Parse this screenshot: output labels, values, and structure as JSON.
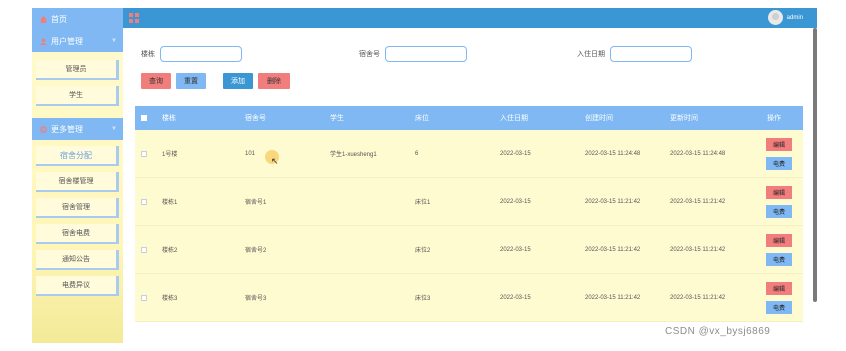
{
  "sidebar": {
    "home_label": "首页",
    "menus": [
      {
        "label": "用户管理",
        "items": [
          "管理员",
          "学生"
        ]
      },
      {
        "label": "更多管理",
        "items": [
          "宿舍分配",
          "宿舍楼管理",
          "宿舍管理",
          "宿舍电费",
          "通知公告",
          "电费异议"
        ]
      }
    ]
  },
  "topbar": {
    "username": "admin"
  },
  "search": {
    "building_label": "楼栋",
    "building_value": "",
    "room_label": "宿舍号",
    "room_value": "",
    "date_label": "入住日期",
    "date_value": ""
  },
  "toolbar": {
    "query": "查询",
    "reset": "重置",
    "add": "添加",
    "delete": "删除"
  },
  "table": {
    "headers": [
      "楼栋",
      "宿舍号",
      "学生",
      "床位",
      "入住日期",
      "创建时间",
      "更新时间",
      "操作"
    ],
    "rows": [
      [
        "1号楼",
        "101",
        "学生1-xuesheng1",
        "6",
        "2022-03-15",
        "2022-03-15 11:24:48",
        "2022-03-15 11:24:48"
      ],
      [
        "楼栋1",
        "宿舍号1",
        "",
        "床位1",
        "2022-03-15",
        "2022-03-15 11:21:42",
        "2022-03-15 11:21:42"
      ],
      [
        "楼栋2",
        "宿舍号2",
        "",
        "床位2",
        "2022-03-15",
        "2022-03-15 11:21:42",
        "2022-03-15 11:21:42"
      ],
      [
        "楼栋3",
        "宿舍号3",
        "",
        "床位3",
        "2022-03-15",
        "2022-03-15 11:21:42",
        "2022-03-15 11:21:42"
      ]
    ],
    "edit_label": "编辑",
    "fee_label": "电费"
  },
  "watermark": "CSDN @vx_bysj6869",
  "colors": {
    "primary": "#3a97d3",
    "light_blue": "#7fb8f2",
    "red": "#f27d7d",
    "row_bg": "#fffbd0"
  }
}
